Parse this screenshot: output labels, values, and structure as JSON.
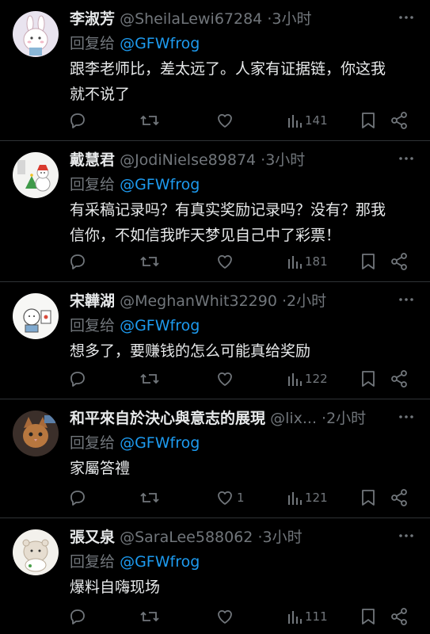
{
  "replies": [
    {
      "name": "李淑芳",
      "handle": "@SheilaLewi67284",
      "time": "3小时",
      "reply_label": "回复给",
      "reply_to": "@GFWfrog",
      "text_lines": [
        "跟李老师比，差太远了。人家有证据链，你这我",
        "就不说了"
      ],
      "like_count": "",
      "views": "141",
      "avatar": "bunny-avatar"
    },
    {
      "name": "戴慧君",
      "handle": "@JodiNielse89874",
      "time": "3小时",
      "reply_label": "回复给",
      "reply_to": "@GFWfrog",
      "text_lines": [
        "有采稿记录吗？有真实奖励记录吗？没有？那我",
        "信你，不如信我昨天梦见自己中了彩票！"
      ],
      "like_count": "",
      "views": "181",
      "avatar": "snowman-avatar"
    },
    {
      "name": "宋韡湖",
      "handle": "@MeghanWhit32290",
      "time": "2小时",
      "reply_label": "回复给",
      "reply_to": "@GFWfrog",
      "text_lines": [
        "想多了，要赚钱的怎么可能真给奖励"
      ],
      "like_count": "",
      "views": "122",
      "avatar": "doodle-avatar"
    },
    {
      "name": "和平來自於決心與意志的展現",
      "handle": "@lix...",
      "time": "2小时",
      "reply_label": "回复给",
      "reply_to": "@GFWfrog",
      "text_lines": [
        "家屬答禮"
      ],
      "like_count": "1",
      "views": "121",
      "avatar": "cat-avatar"
    },
    {
      "name": "張又泉",
      "handle": "@SaraLee588062",
      "time": "3小时",
      "reply_label": "回复给",
      "reply_to": "@GFWfrog",
      "text_lines": [
        "爆料自嗨现场"
      ],
      "like_count": "",
      "views": "111",
      "avatar": "plush-avatar"
    }
  ],
  "icons": {
    "reply": "reply-icon",
    "retweet": "retweet-icon",
    "like": "heart-icon",
    "views": "views-icon",
    "bookmark": "bookmark-icon",
    "share": "share-icon",
    "more": "more-icon"
  },
  "colors": {
    "background": "#000000",
    "text": "#e7e9ea",
    "muted": "#71767b",
    "link": "#1d9bf0",
    "divider": "#2f3336"
  }
}
